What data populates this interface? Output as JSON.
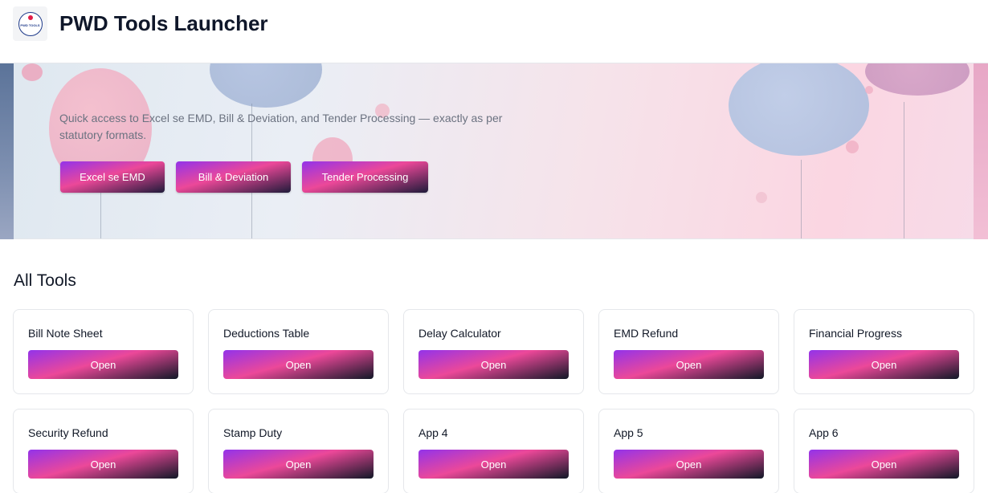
{
  "header": {
    "logo_text": "PWD TOOLS",
    "title": "PWD Tools Launcher"
  },
  "hero": {
    "description": "Quick access to Excel se EMD, Bill & Deviation, and Tender Processing — exactly as per statutory formats.",
    "buttons": [
      "Excel se EMD",
      "Bill & Deviation",
      "Tender Processing"
    ]
  },
  "tools": {
    "title": "All Tools",
    "open_label": "Open",
    "items": [
      "Bill Note Sheet",
      "Deductions Table",
      "Delay Calculator",
      "EMD Refund",
      "Financial Progress",
      "Security Refund",
      "Stamp Duty",
      "App 4",
      "App 5",
      "App 6"
    ]
  },
  "colors": {
    "accent_start": "#9333ea",
    "accent_mid": "#ec4899",
    "accent_end": "#111827"
  }
}
